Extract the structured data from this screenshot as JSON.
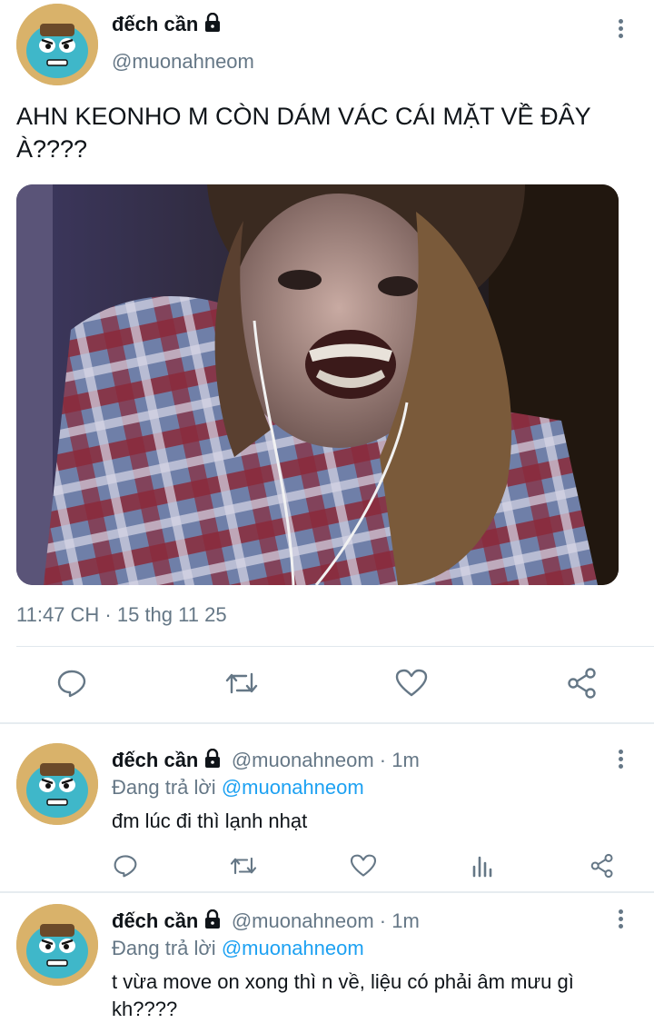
{
  "main_tweet": {
    "display_name": "đếch cần",
    "handle": "@muonahneom",
    "text_line1": "AHN KEONHO M CÒN DÁM VÁC CÁI MẶT VỀ ĐÂY",
    "text_line2": "À????",
    "timestamp": "11:47 CH · 15 thg 11 25"
  },
  "replies": [
    {
      "display_name": "đếch cần",
      "handle_time": "@muonahneom · 1m",
      "replying_prefix": "Đang trả lời",
      "replying_to": "@muonahneom",
      "text_line1": "đm lúc đi thì lạnh nhạt",
      "text_line2": ""
    },
    {
      "display_name": "đếch cần",
      "handle_time": "@muonahneom · 1m",
      "replying_prefix": "Đang trả lời",
      "replying_to": "@muonahneom",
      "text_line1": "t vừa move on xong thì n về, liệu có phải âm mưu gì",
      "text_line2": "kh????"
    }
  ],
  "icons": {
    "reply": "speech-bubble-icon",
    "retweet": "retweet-icon",
    "like": "heart-icon",
    "analytics": "bar-chart-icon",
    "share": "share-icon",
    "lock": "lock-icon",
    "more": "more-vertical-icon"
  },
  "colors": {
    "link": "#1da1f2",
    "secondary_text": "#657786",
    "icon": "#657786",
    "text": "#0f1419",
    "divider": "#e1e8ed"
  }
}
